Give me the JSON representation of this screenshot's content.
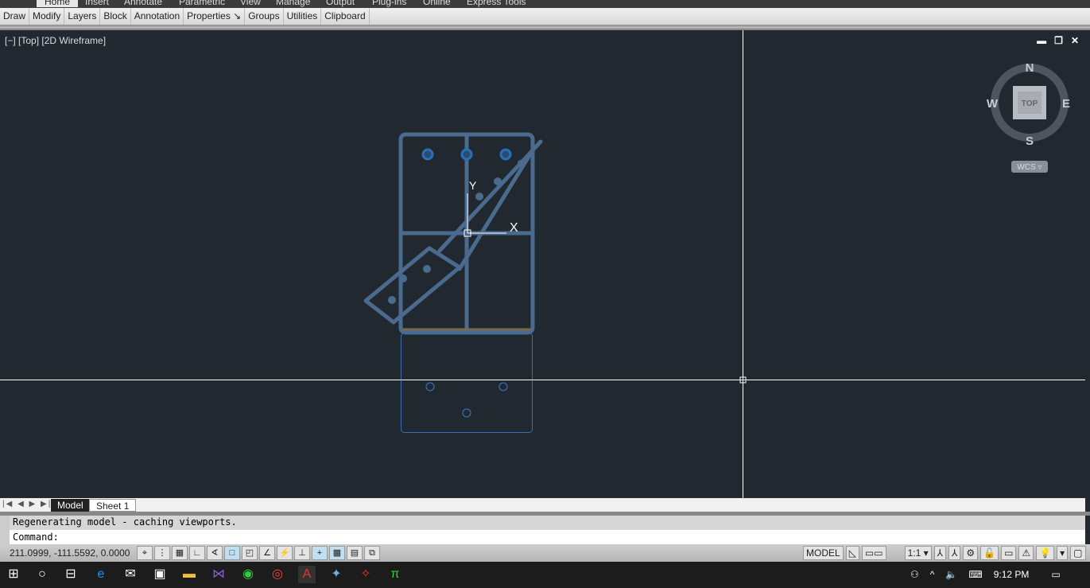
{
  "ribbon": {
    "tabs": [
      "Home",
      "Insert",
      "Annotate",
      "Parametric",
      "View",
      "Manage",
      "Output",
      "Plug-ins",
      "Online",
      "Express Tools"
    ],
    "active": "Home"
  },
  "panels": [
    "Draw",
    "Modify",
    "Layers",
    "Block",
    "Annotation",
    "Properties ↘",
    "Groups",
    "Utilities",
    "Clipboard"
  ],
  "viewport": {
    "label": "[−] [Top] [2D Wireframe]",
    "min": "▬",
    "restore": "❐",
    "close": "✕"
  },
  "viewcube": {
    "n": "N",
    "s": "S",
    "e": "E",
    "w": "W",
    "face": "TOP",
    "ucs": "WCS ▿"
  },
  "ucs": {
    "x": "X",
    "y": "Y"
  },
  "layout_tabs": {
    "nav": "|◀ ◀ ▶ ▶|",
    "model": "Model",
    "sheet": "Sheet 1"
  },
  "command": {
    "history": "Regenerating model - caching viewports.",
    "prompt": "Command:"
  },
  "status": {
    "coords": "211.0999, -111.5592, 0.0000",
    "model": "MODEL",
    "scale": "1:1 ▾",
    "toggles": [
      "snap",
      "grid",
      "ortho",
      "polar",
      "osnap",
      "3dosnap",
      "otrack",
      "ducs",
      "dyn",
      "lwt",
      "tpy",
      "qp",
      "sc"
    ]
  },
  "colors": {
    "viewport_bg": "#212830",
    "geometry": "#4a6a8e",
    "holes": "#2a6fb5",
    "crosshair": "#ffffff"
  },
  "taskbar": {
    "apps": [
      "windows-start",
      "cortana",
      "task-view",
      "edge",
      "mail",
      "store",
      "file-explorer",
      "visual-studio",
      "whatsapp",
      "chrome",
      "autocad",
      "app-blue",
      "app-red",
      "pi-app"
    ],
    "time": "9:12 PM"
  }
}
